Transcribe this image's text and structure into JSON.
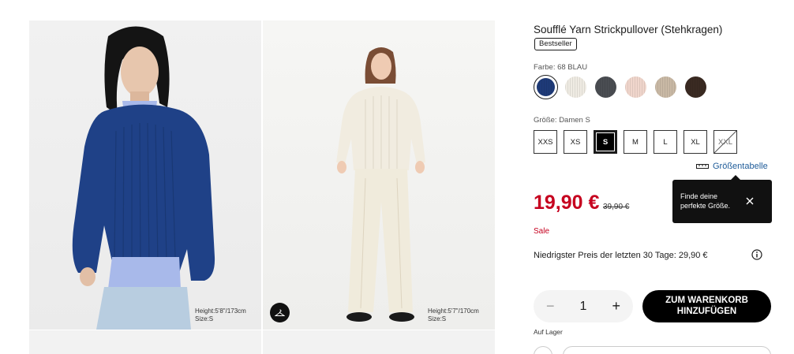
{
  "product": {
    "title": "Soufflé Yarn Strickpullover (Stehkragen)",
    "badge": "Bestseller",
    "color_label": "Farbe: 68 BLAU",
    "size_label": "Größe: Damen S",
    "size_guide": "Größentabelle",
    "price": "19,90 €",
    "old_price": "39,90 €",
    "sale": "Sale",
    "lowest_price": "Niedrigster Preis der letzten 30 Tage: 29,90 €",
    "quantity": "1",
    "add_to_cart_line1": "ZUM WARENKORB",
    "add_to_cart_line2": "HINZUFÜGEN",
    "stock": "Auf Lager"
  },
  "tooltip": {
    "text": "Finde deine perfekte Größe."
  },
  "colors": [
    {
      "name": "blue",
      "hex": "#1e3a78",
      "selected": true
    },
    {
      "name": "off-white",
      "hex": "#efebe3",
      "selected": false
    },
    {
      "name": "dark-gray",
      "hex": "#4a4d52",
      "selected": false
    },
    {
      "name": "pink",
      "hex": "#f0d6cc",
      "selected": false
    },
    {
      "name": "beige",
      "hex": "#c9b9a5",
      "selected": false
    },
    {
      "name": "dark-brown",
      "hex": "#3a2a22",
      "selected": false
    }
  ],
  "sizes": [
    {
      "label": "XXS",
      "state": "available"
    },
    {
      "label": "XS",
      "state": "available"
    },
    {
      "label": "S",
      "state": "selected"
    },
    {
      "label": "M",
      "state": "available"
    },
    {
      "label": "L",
      "state": "available"
    },
    {
      "label": "XL",
      "state": "available"
    },
    {
      "label": "XXL",
      "state": "disabled"
    }
  ],
  "gallery": {
    "left_info_line1": "Height:5'8\"/173cm",
    "left_info_line2": "Size:S",
    "right_info_line1": "Height:5'7\"/170cm",
    "right_info_line2": "Size:S"
  },
  "icons": {
    "hanger": "hanger-icon",
    "ruler": "ruler-icon",
    "close": "close-icon",
    "info": "info-icon"
  },
  "accent": {
    "sale_red": "#c6011f",
    "link_blue": "#1f5c99"
  }
}
